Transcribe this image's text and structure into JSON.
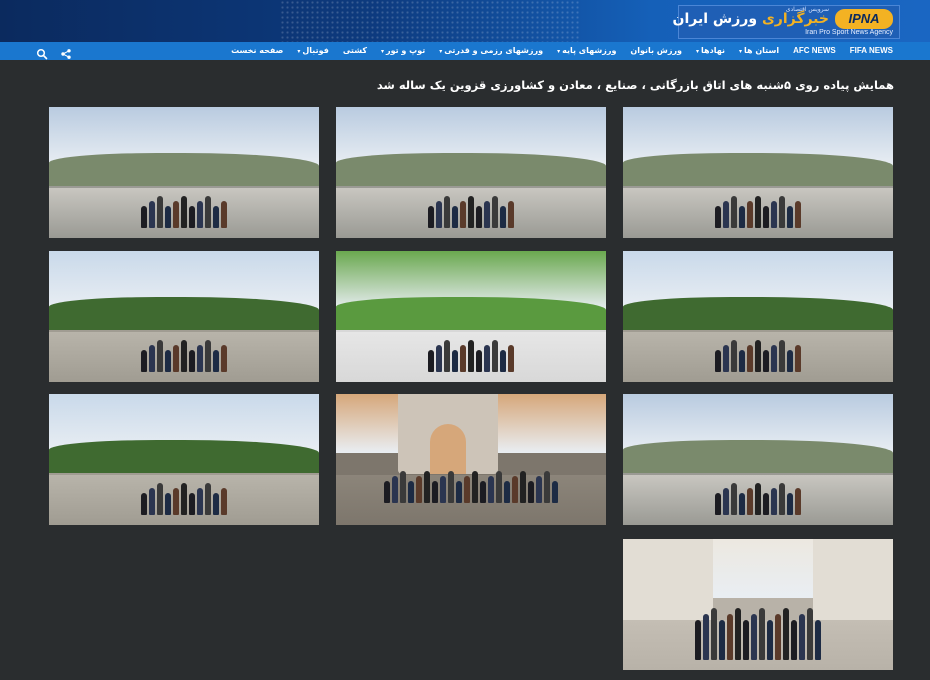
{
  "header": {
    "logo_badge": "IPNA",
    "logo_tagline": "سرویس اقتصادی",
    "logo_title_a": "خبرگزاری",
    "logo_title_b": " ورزش ایران",
    "logo_subtitle": "Iran Pro Sport News Agency"
  },
  "nav": {
    "items": [
      {
        "label": "صفحه نخست",
        "dropdown": false
      },
      {
        "label": "فوتبال",
        "dropdown": true
      },
      {
        "label": "کشتی",
        "dropdown": false
      },
      {
        "label": "توپ و تور",
        "dropdown": true
      },
      {
        "label": "ورزشهای رزمی و قدرتی",
        "dropdown": true
      },
      {
        "label": "ورزشهای پایه",
        "dropdown": true
      },
      {
        "label": "ورزش بانوان",
        "dropdown": false
      },
      {
        "label": "نهادها",
        "dropdown": true
      },
      {
        "label": "استان ها",
        "dropdown": true
      },
      {
        "label": "AFC NEWS",
        "dropdown": false
      },
      {
        "label": "FIFA NEWS",
        "dropdown": false
      }
    ],
    "icons": [
      "share-icon",
      "search-icon"
    ]
  },
  "article": {
    "title": "همایش پیاده روی ۵شنبه های اتاق بازرگانی ، صنایع ، معادن و کشاورزی قزوین یک ساله شد"
  },
  "colors": {
    "header_dark": "#0b2a5e",
    "header_light": "#1a66c2",
    "nav_bg": "#1a77cf",
    "page_bg": "#2a2d2f",
    "logo_accent": "#f3b223"
  },
  "gallery": {
    "photos": [
      {
        "name": "photo-walkers-road-building",
        "scene": "road"
      },
      {
        "name": "photo-walkers-road-trees",
        "scene": "road"
      },
      {
        "name": "photo-walkers-city-road",
        "scene": "road"
      },
      {
        "name": "photo-walkers-park-path",
        "scene": "park"
      },
      {
        "name": "photo-group-on-lawn",
        "scene": "lawn"
      },
      {
        "name": "photo-walkers-park-trees",
        "scene": "park"
      },
      {
        "name": "photo-walkers-dirt-path",
        "scene": "road"
      },
      {
        "name": "photo-group-monument",
        "scene": "monument"
      },
      {
        "name": "photo-walkers-gravel-road",
        "scene": "park"
      },
      {
        "name": "photo-group-portrait-monument",
        "scene": "portrait"
      }
    ]
  }
}
